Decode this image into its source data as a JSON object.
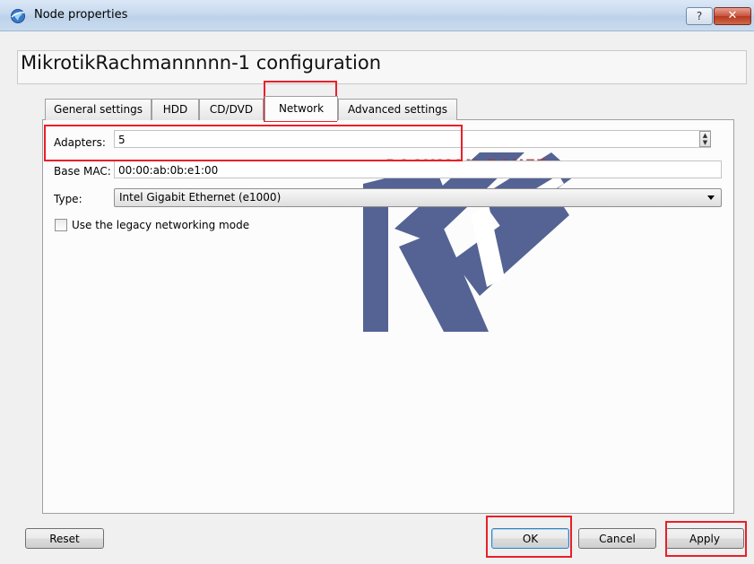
{
  "window": {
    "title": "Node properties",
    "help_label": "?",
    "close_label": "✕"
  },
  "header": {
    "title": "MikrotikRachmannnnn-1 configuration"
  },
  "tabs": [
    {
      "label": "General settings",
      "active": false
    },
    {
      "label": "HDD",
      "active": false
    },
    {
      "label": "CD/DVD",
      "active": false
    },
    {
      "label": "Network",
      "active": true
    },
    {
      "label": "Advanced settings",
      "active": false
    }
  ],
  "network": {
    "adapters_label": "Adapters:",
    "adapters_value": "5",
    "base_mac_label": "Base MAC:",
    "base_mac_value": "00:00:ab:0b:e1:00",
    "type_label": "Type:",
    "type_value": "Intel Gigabit Ethernet (e1000)",
    "legacy_label": "Use the legacy networking mode",
    "legacy_checked": false
  },
  "buttons": {
    "reset": "Reset",
    "ok": "OK",
    "cancel": "Cancel",
    "apply": "Apply"
  },
  "watermark": {
    "text": "RACHMAN-BANEZ"
  },
  "colors": {
    "highlight": "#e8202a",
    "watermark": "#3d4f86"
  }
}
